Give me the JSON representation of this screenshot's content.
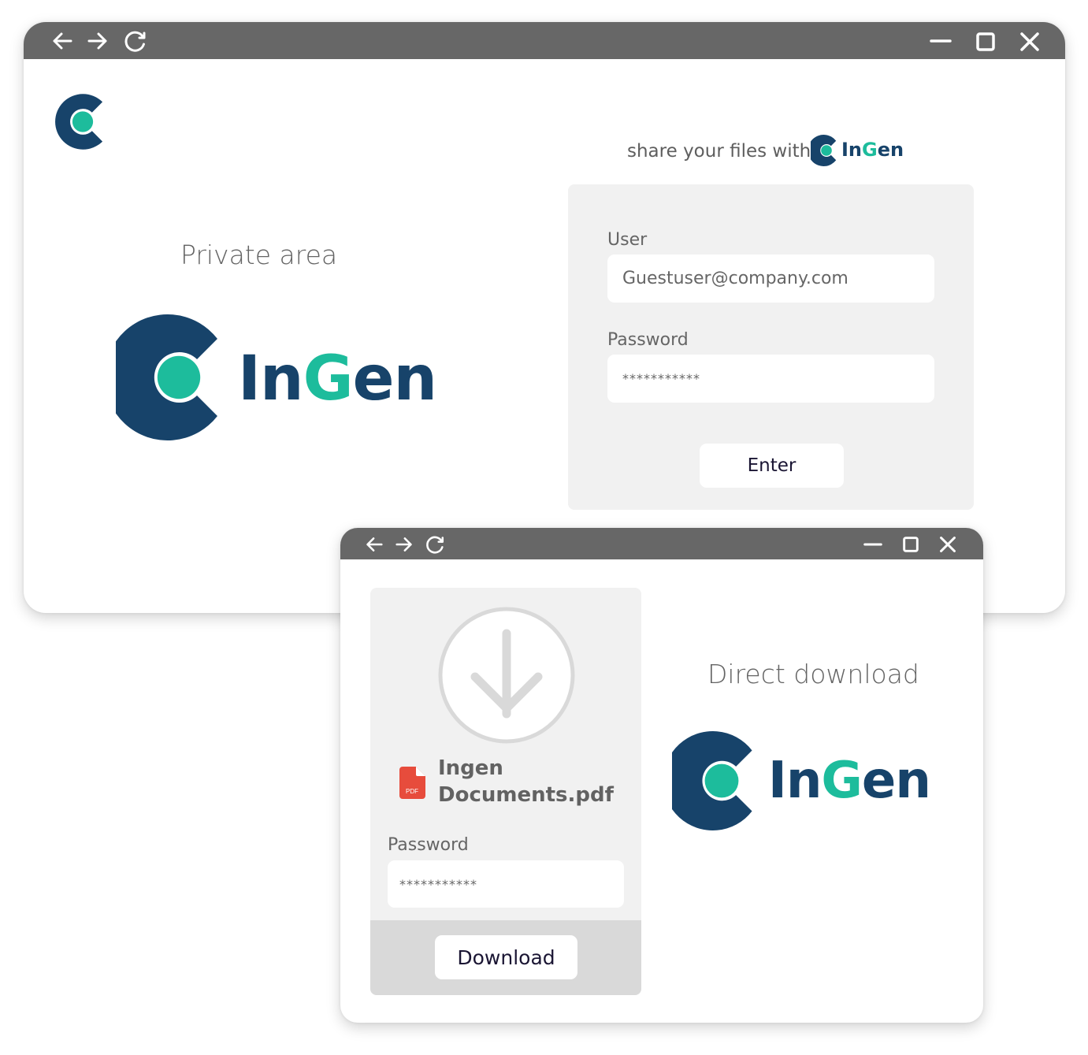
{
  "colors": {
    "brand_dark": "#17436a",
    "brand_teal": "#1dbc9c",
    "titlebar": "#676767",
    "panel": "#f1f1f1",
    "panel_footer": "#d9d9d9",
    "pdf_red": "#e74c3c"
  },
  "login_window": {
    "titlebar": {
      "icons": [
        "back-arrow-icon",
        "forward-arrow-icon",
        "reload-icon",
        "minimize-icon",
        "maximize-icon",
        "close-icon"
      ]
    },
    "heading": "Private area",
    "brand": {
      "part1": "In",
      "part2": "G",
      "part3": "en"
    },
    "tagline": "share your files with",
    "tagline_brand": {
      "part1": "In",
      "part2": "G",
      "part3": "en"
    },
    "form": {
      "user_label": "User",
      "user_value": "Guestuser@company.com",
      "password_label": "Password",
      "password_value": "***********",
      "submit_label": "Enter"
    }
  },
  "download_window": {
    "titlebar": {
      "icons": [
        "back-arrow-icon",
        "forward-arrow-icon",
        "reload-icon",
        "minimize-icon",
        "maximize-icon",
        "close-icon"
      ]
    },
    "file": {
      "icon_label": "PDF",
      "name_line1": "Ingen",
      "name_line2": "Documents.pdf"
    },
    "password_label": "Password",
    "password_value": "***********",
    "download_label": "Download",
    "heading": "Direct download",
    "brand": {
      "part1": "In",
      "part2": "G",
      "part3": "en"
    }
  }
}
